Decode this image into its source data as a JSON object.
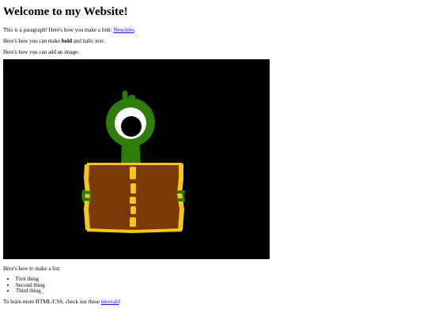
{
  "page": {
    "heading": "Welcome to my Website!",
    "p1": {
      "text": "This is a paragraph! Here's how you make a link: ",
      "link": "Neocities",
      "after": "."
    },
    "p2": {
      "before": "Here's how you can make ",
      "bold": "bold",
      "middle": " and ",
      "italic": "italic",
      "after": " text."
    },
    "p3": "Here's how you can add an image:",
    "image": {
      "background": "#000000",
      "colors": {
        "stem": "#2e7d0a",
        "book": "#7a3a0a",
        "binding": "#f4c71b",
        "eye_white": "#ffffff",
        "pupil": "#000000"
      }
    },
    "p4": "Here's how to make a list:",
    "list": [
      "First thing",
      "Second thing",
      "Third thing"
    ],
    "p5": {
      "before": "To learn more HTML/CSS, check out these ",
      "link": "tutorials",
      "after": "!"
    }
  }
}
